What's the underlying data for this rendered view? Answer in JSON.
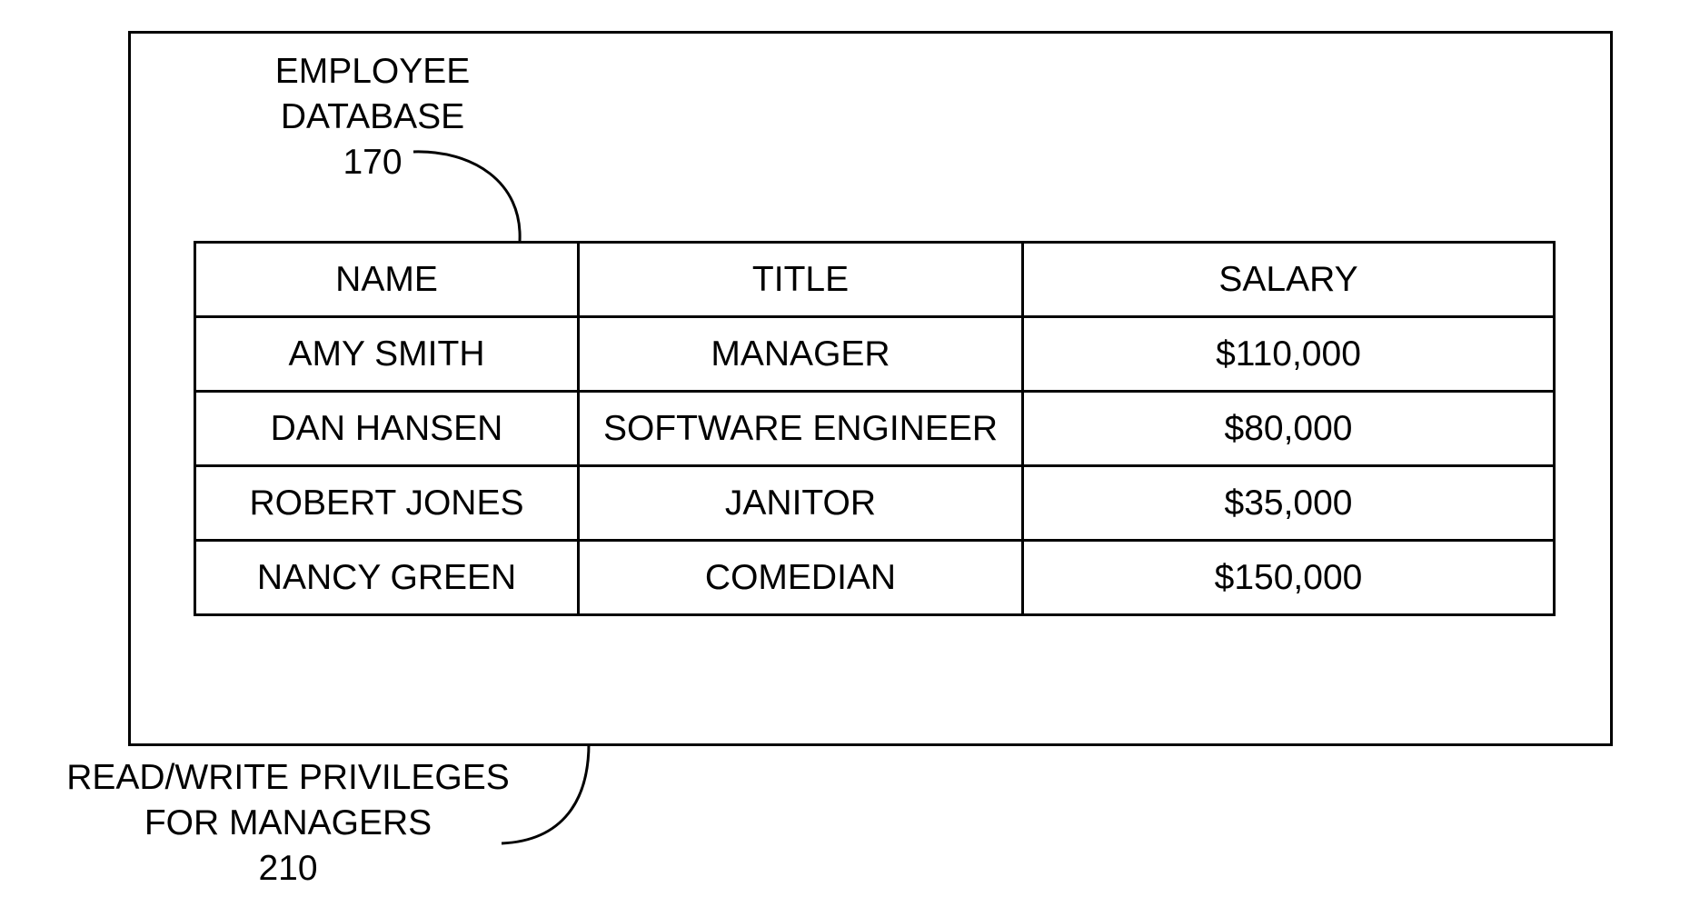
{
  "database_label": {
    "line1": "EMPLOYEE",
    "line2": "DATABASE",
    "ref": "170"
  },
  "privileges_label": {
    "line1": "READ/WRITE PRIVILEGES",
    "line2": "FOR MANAGERS",
    "ref": "210"
  },
  "table": {
    "headers": [
      "NAME",
      "TITLE",
      "SALARY"
    ],
    "rows": [
      [
        "AMY SMITH",
        "MANAGER",
        "$110,000"
      ],
      [
        "DAN HANSEN",
        "SOFTWARE ENGINEER",
        "$80,000"
      ],
      [
        "ROBERT JONES",
        "JANITOR",
        "$35,000"
      ],
      [
        "NANCY GREEN",
        "COMEDIAN",
        "$150,000"
      ]
    ]
  }
}
